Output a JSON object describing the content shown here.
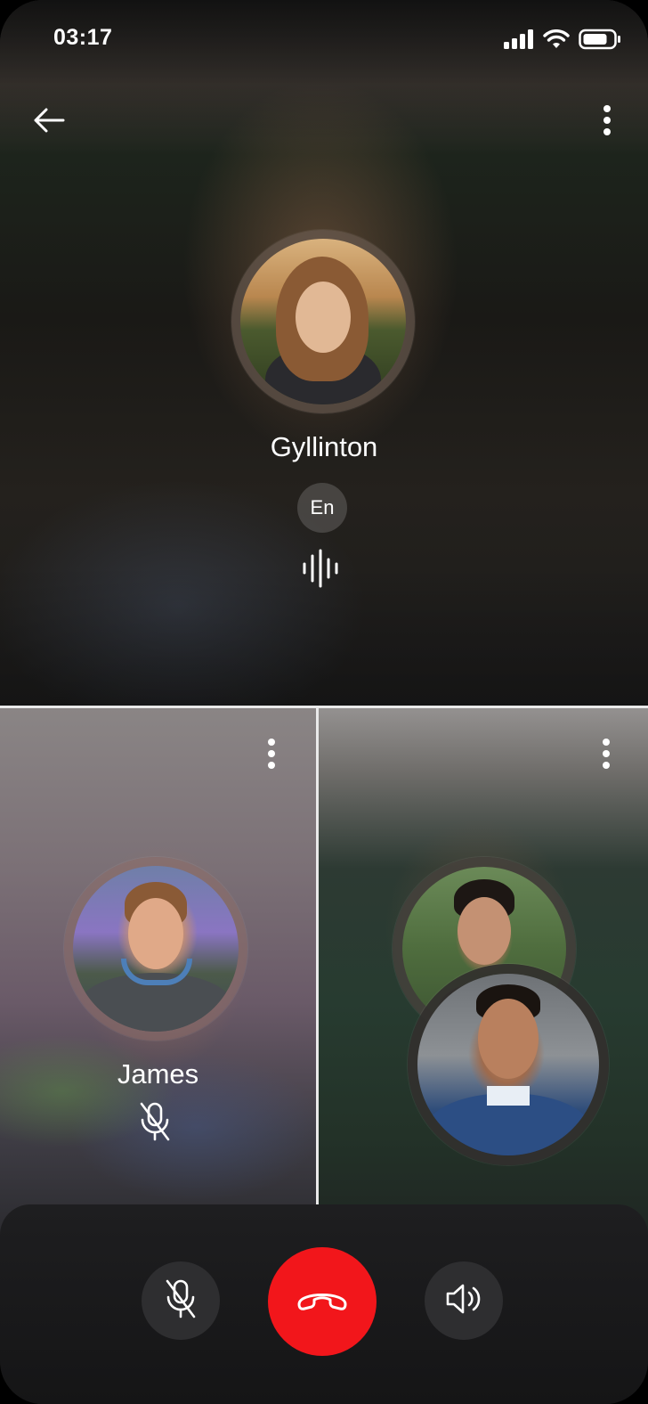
{
  "status_bar": {
    "time": "03:17",
    "icons": [
      "cellular-signal-icon",
      "wifi-icon",
      "battery-icon"
    ]
  },
  "header": {
    "back_icon": "arrow-left-icon",
    "menu_icon": "more-vertical-icon"
  },
  "main_caller": {
    "name": "Gyllinton",
    "language": "En",
    "speaking_icon": "voice-wave-icon"
  },
  "participants": [
    {
      "name": "James",
      "muted": true,
      "menu_icon": "more-vertical-icon"
    },
    {
      "name": "",
      "menu_icon": "more-vertical-icon"
    }
  ],
  "controls": {
    "mute_icon": "mic-off-icon",
    "end_call_icon": "phone-hangup-icon",
    "speaker_icon": "speaker-icon",
    "end_call_color": "#f2161b"
  },
  "colors": {
    "divider": "#e9e9e9",
    "control_bar": "#1e1e20",
    "button_bg": "#2e2e30"
  }
}
